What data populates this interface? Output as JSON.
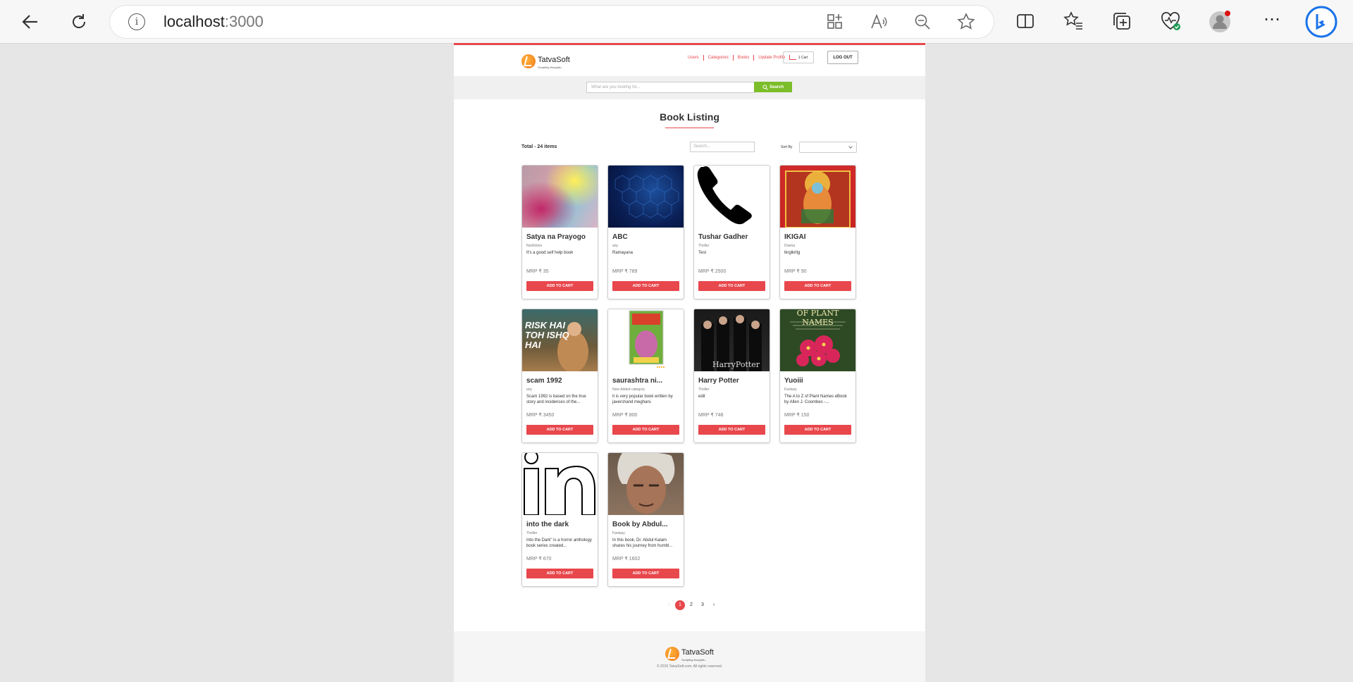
{
  "browser": {
    "url_host": "localhost",
    "url_port": ":3000"
  },
  "header": {
    "logo_name": "TatvaSoft",
    "logo_tagline": "Sculpting thoughts...",
    "nav": [
      "Users",
      "Categories",
      "Books",
      "Update Profile"
    ],
    "cart_count": "1",
    "cart_label": "Cart",
    "logout_label": "LOG OUT"
  },
  "search": {
    "placeholder": "What are you looking for...",
    "button_label": "Search"
  },
  "listing": {
    "title": "Book Listing",
    "total_text": "Total - 24 items",
    "search_placeholder": "Search...",
    "sort_label": "Sort By",
    "sort_value": ""
  },
  "books": [
    {
      "name": "Satya na Prayogo",
      "category": "Nonfiction",
      "description": "It's a good self help book",
      "price": "MRP ₹ 35",
      "button": "ADD TO CART",
      "image": "rainbow-blur"
    },
    {
      "name": "ABC",
      "category": "any",
      "description": "Ramayana",
      "price": "MRP ₹ 789",
      "button": "ADD TO CART",
      "image": "hexagon-tech"
    },
    {
      "name": "Tushar Gadher",
      "category": "Thriller",
      "description": "Test",
      "price": "MRP ₹ 2500",
      "button": "ADD TO CART",
      "image": "phone-icon"
    },
    {
      "name": "IKIGAI",
      "category": "Drama",
      "description": "lkrglkrtlg",
      "price": "MRP ₹ 90",
      "button": "ADD TO CART",
      "image": "deity-painting"
    },
    {
      "name": "scam 1992",
      "category": "any",
      "description": "Scam 1992 is based on the true story and incidences of the...",
      "price": "MRP ₹ 3450",
      "button": "ADD TO CART",
      "image": "scam-poster"
    },
    {
      "name": "saurashtra ni...",
      "category": "New Added category",
      "description": "it is very popular book written by javerchand meghani.",
      "price": "MRP ₹ 800",
      "button": "ADD TO CART",
      "image": "book-cover-green"
    },
    {
      "name": "Harry Potter",
      "category": "Thriller",
      "description": "edit",
      "price": "MRP ₹ 748",
      "button": "ADD TO CART",
      "image": "harry-potter-poster"
    },
    {
      "name": "Yuoiii",
      "category": "Fantasy",
      "description": "The A to Z of Plant Names eBook by Allen J. Coombes -...",
      "price": "MRP ₹ 150",
      "button": "ADD TO CART",
      "image": "plant-names-cover"
    },
    {
      "name": "into the dark",
      "category": "Thriller",
      "description": "Into the Dark\" is a horror anthology book series created...",
      "price": "MRP ₹ 670",
      "button": "ADD TO CART",
      "image": "linkedin-logo"
    },
    {
      "name": "Book by Abdul...",
      "category": "Fantasy",
      "description": "In this book, Dr. Abdul Kalam shares his journey from humbl...",
      "price": "MRP ₹ 1602",
      "button": "ADD TO CART",
      "image": "portrait-photo"
    }
  ],
  "cover_text": {
    "scam": "RISK HAI TOH ISHQ HAI",
    "harry": "HarryPotter",
    "plant": "OF PLANT NAMES"
  },
  "pagination": {
    "prev": "‹",
    "pages": [
      "1",
      "2",
      "3"
    ],
    "next": "›",
    "current": "1"
  },
  "footer": {
    "logo_name": "TatvaSoft",
    "logo_tagline": "Sculpting thoughts...",
    "copyright": "© 2015 TatvaSoft.com. All rights reserved."
  },
  "colors": {
    "accent": "#e8474c",
    "search_button": "#7cbd2a"
  }
}
